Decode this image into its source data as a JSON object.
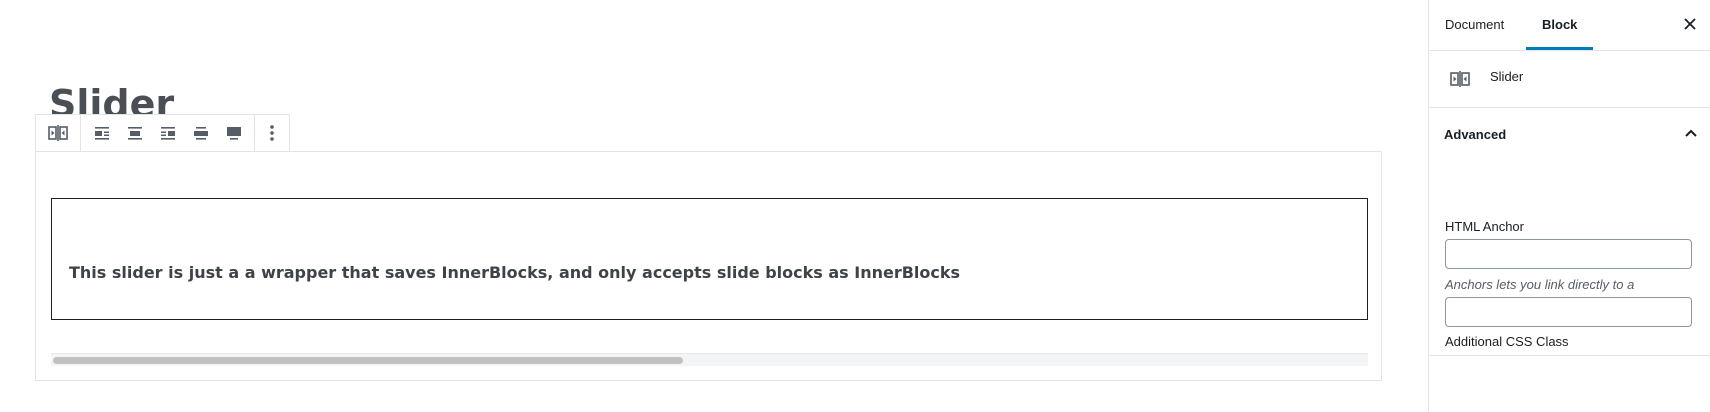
{
  "editor": {
    "post_title": "Slider",
    "slider_text": "This slider is just a a wrapper that saves InnerBlocks, and only accepts slide blocks as InnerBlocks"
  },
  "toolbar": {
    "buttons": [
      {
        "icon": "slider-block-icon"
      },
      {
        "icon": "align-left-icon"
      },
      {
        "icon": "align-center-icon"
      },
      {
        "icon": "align-right-icon"
      },
      {
        "icon": "align-wide-icon"
      },
      {
        "icon": "align-full-icon"
      },
      {
        "icon": "more-options-icon"
      }
    ]
  },
  "sidebar": {
    "tabs": [
      {
        "label": "Document",
        "active": false
      },
      {
        "label": "Block",
        "active": true
      }
    ],
    "close_icon": "close-icon",
    "block_card": {
      "icon": "slider-block-icon",
      "title": "Slider"
    },
    "advanced": {
      "title": "Advanced",
      "expanded": true,
      "html_anchor_label": "HTML Anchor",
      "html_anchor_value": "",
      "html_anchor_help": "Anchors lets you link directly to a section on a page.",
      "css_class_label": "Additional CSS Class",
      "css_class_value": ""
    }
  },
  "colors": {
    "accent": "#007cba",
    "text": "#191e23",
    "border": "#e2e4e7"
  }
}
